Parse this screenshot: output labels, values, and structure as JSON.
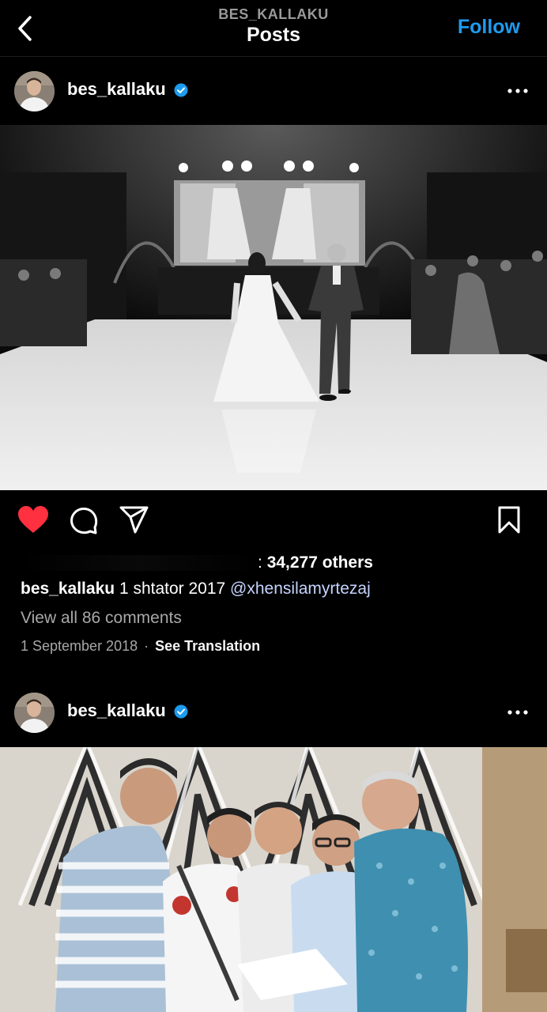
{
  "header": {
    "subtitle": "BES_KALLAKU",
    "title": "Posts",
    "follow_label": "Follow"
  },
  "posts": [
    {
      "username": "bes_kallaku",
      "verified": true,
      "likes_prefix": ":",
      "likes_count": "34,277 others",
      "caption_user": "bes_kallaku",
      "caption_text": "1 shtator 2017",
      "caption_mention": "@xhensilamyrtezaj",
      "view_comments": "View all 86 comments",
      "date": "1 September 2018",
      "separator": "·",
      "see_translation": "See Translation",
      "liked": true
    },
    {
      "username": "bes_kallaku",
      "verified": true
    }
  ],
  "colors": {
    "background": "#000000",
    "accent_blue": "#1f9bf0",
    "like_red": "#ff3040",
    "verified_blue": "#1d9bf0",
    "muted_text": "#a8a8a8"
  },
  "icons": [
    "back-arrow-icon",
    "verified-badge-icon",
    "more-dots-icon",
    "heart-icon",
    "comment-icon",
    "share-icon",
    "bookmark-icon"
  ]
}
